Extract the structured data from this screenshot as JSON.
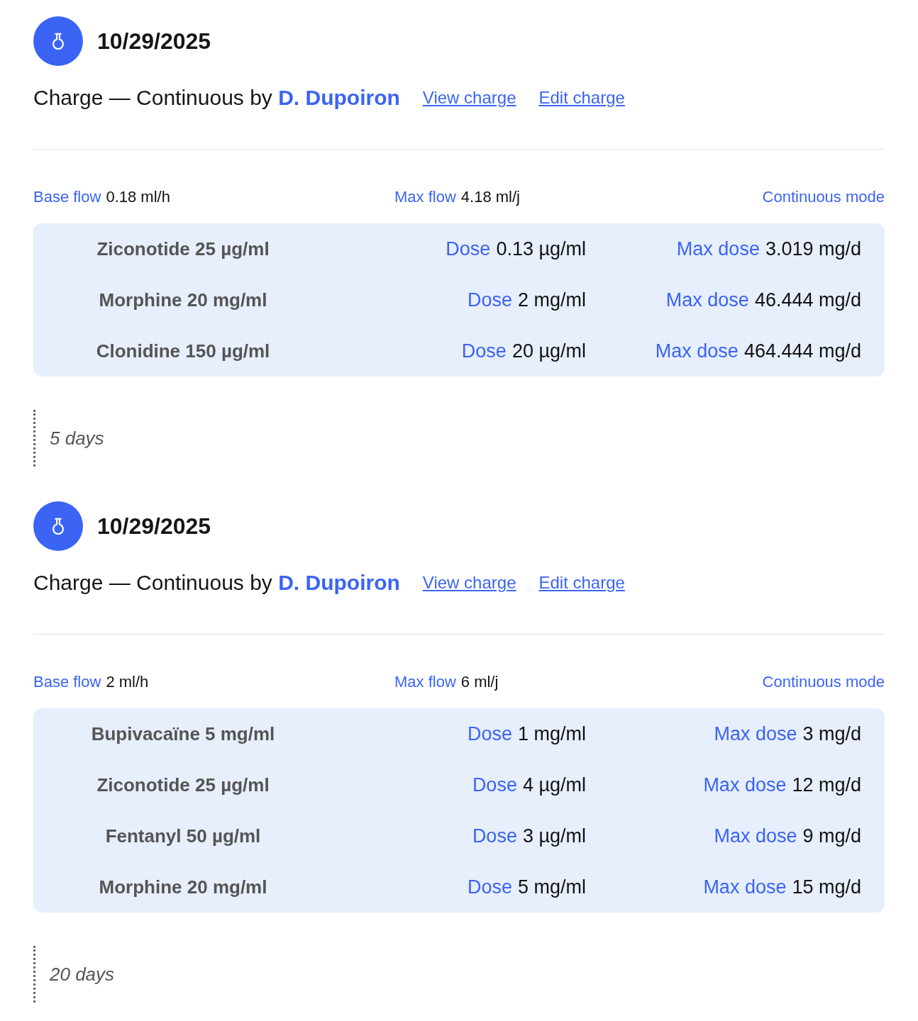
{
  "entries": [
    {
      "date": "10/29/2025",
      "headline": "Charge — Continuous by **D. Dupoiron**",
      "links": [
        "View charge",
        "Edit charge"
      ],
      "flows": [
        {
          "label": "Base flow",
          "value": "0.18 ml/h"
        },
        {
          "label": "Max flow",
          "value": "4.18 ml/j"
        }
      ],
      "mode": "Continuous mode",
      "drugs": [
        {
          "name": "Ziconotide 25 µg/ml",
          "dose_label": "Dose",
          "dose": "0.13 µg/ml",
          "max_dose_label": "Max dose",
          "max_dose": "3.019 mg/d"
        },
        {
          "name": "Morphine 20 mg/ml",
          "dose_label": "Dose",
          "dose": "2 mg/ml",
          "max_dose_label": "Max dose",
          "max_dose": "46.444 mg/d"
        },
        {
          "name": "Clonidine 150 µg/ml",
          "dose_label": "Dose",
          "dose": "20 µg/ml",
          "max_dose_label": "Max dose",
          "max_dose": "464.444 mg/d"
        }
      ],
      "interval": "5 days"
    },
    {
      "date": "10/29/2025",
      "headline": "Charge — Continuous by **D. Dupoiron**",
      "links": [
        "View charge",
        "Edit charge"
      ],
      "flows": [
        {
          "label": "Base flow",
          "value": "2 ml/h"
        },
        {
          "label": "Max flow",
          "value": "6 ml/j"
        }
      ],
      "mode": "Continuous mode",
      "drugs": [
        {
          "name": "Bupivacaïne 5 mg/ml",
          "dose_label": "Dose",
          "dose": "1 mg/ml",
          "max_dose_label": "Max dose",
          "max_dose": "3 mg/d"
        },
        {
          "name": "Ziconotide 25 µg/ml",
          "dose_label": "Dose",
          "dose": "4 µg/ml",
          "max_dose_label": "Max dose",
          "max_dose": "12 mg/d"
        },
        {
          "name": "Fentanyl 50 µg/ml",
          "dose_label": "Dose",
          "dose": "3 µg/ml",
          "max_dose_label": "Max dose",
          "max_dose": "9 mg/d"
        },
        {
          "name": "Morphine 20 mg/ml",
          "dose_label": "Dose",
          "dose": "5 mg/ml",
          "max_dose_label": "Max dose",
          "max_dose": "15 mg/d"
        }
      ],
      "interval": "20 days"
    }
  ]
}
